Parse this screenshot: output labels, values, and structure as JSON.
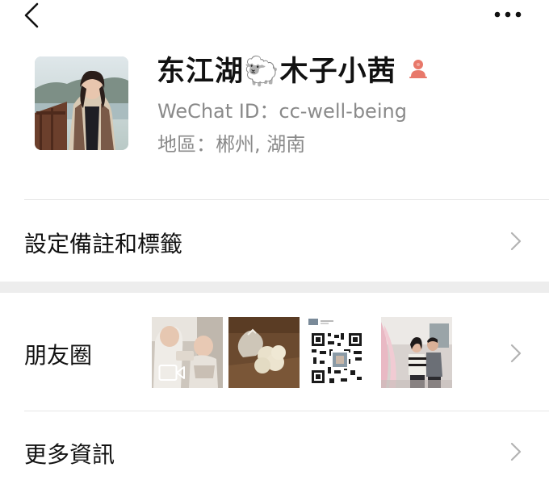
{
  "nav": {
    "back_icon": "chevron-left-icon",
    "more_icon": "more-dots-icon"
  },
  "profile": {
    "name": "东江湖🐑木子小茜",
    "gender_icon": "female-person-icon",
    "wechat_id_label": "WeChat ID：",
    "wechat_id": "cc-well-being",
    "region_label": "地區：",
    "region": "郴州, 湖南"
  },
  "rows": {
    "remark_label": "設定備註和標籤",
    "moments_label": "朋友圈",
    "more_label": "更多資訊"
  },
  "moments": {
    "thumbnails": [
      {
        "kind": "video-photo",
        "desc": "baby"
      },
      {
        "kind": "photo",
        "desc": "items on table"
      },
      {
        "kind": "qr-code-image"
      },
      {
        "kind": "photo",
        "desc": "two people in room"
      }
    ]
  },
  "colors": {
    "accent_gender": "#e8786a",
    "secondary_text": "#8a8a8a",
    "divider": "#e6e6e6",
    "section_gap": "#ededed"
  }
}
